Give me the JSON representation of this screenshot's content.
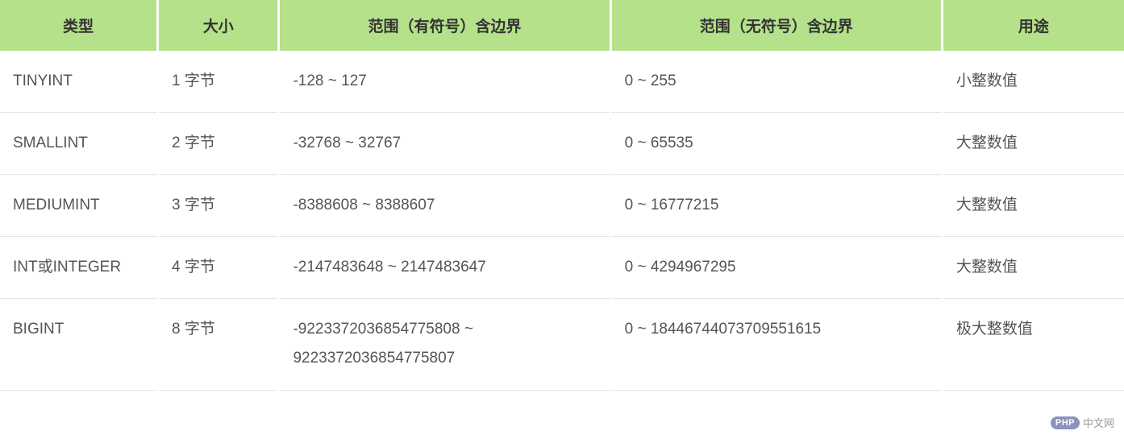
{
  "table": {
    "headers": {
      "type": "类型",
      "size": "大小",
      "signed": "范围（有符号）含边界",
      "unsigned": "范围（无符号）含边界",
      "usage": "用途"
    },
    "rows": [
      {
        "type": "TINYINT",
        "size": "1 字节",
        "signed": "-128 ~ 127",
        "unsigned": "0 ~ 255",
        "usage": "小整数值"
      },
      {
        "type": "SMALLINT",
        "size": "2 字节",
        "signed": "-32768 ~ 32767",
        "unsigned": "0 ~ 65535",
        "usage": "大整数值"
      },
      {
        "type": "MEDIUMINT",
        "size": "3 字节",
        "signed": "-8388608 ~ 8388607",
        "unsigned": "0 ~ 16777215",
        "usage": "大整数值"
      },
      {
        "type": "INT或INTEGER",
        "size": "4 字节",
        "signed": "-2147483648 ~ 2147483647",
        "unsigned": "0 ~ 4294967295",
        "usage": "大整数值"
      },
      {
        "type": "BIGINT",
        "size": "8 字节",
        "signed": "-9223372036854775808 ~ 9223372036854775807",
        "unsigned": "0 ~ 18446744073709551615",
        "usage": "极大整数值"
      }
    ]
  },
  "watermark": {
    "badge": "PHP",
    "text": "中文网"
  }
}
